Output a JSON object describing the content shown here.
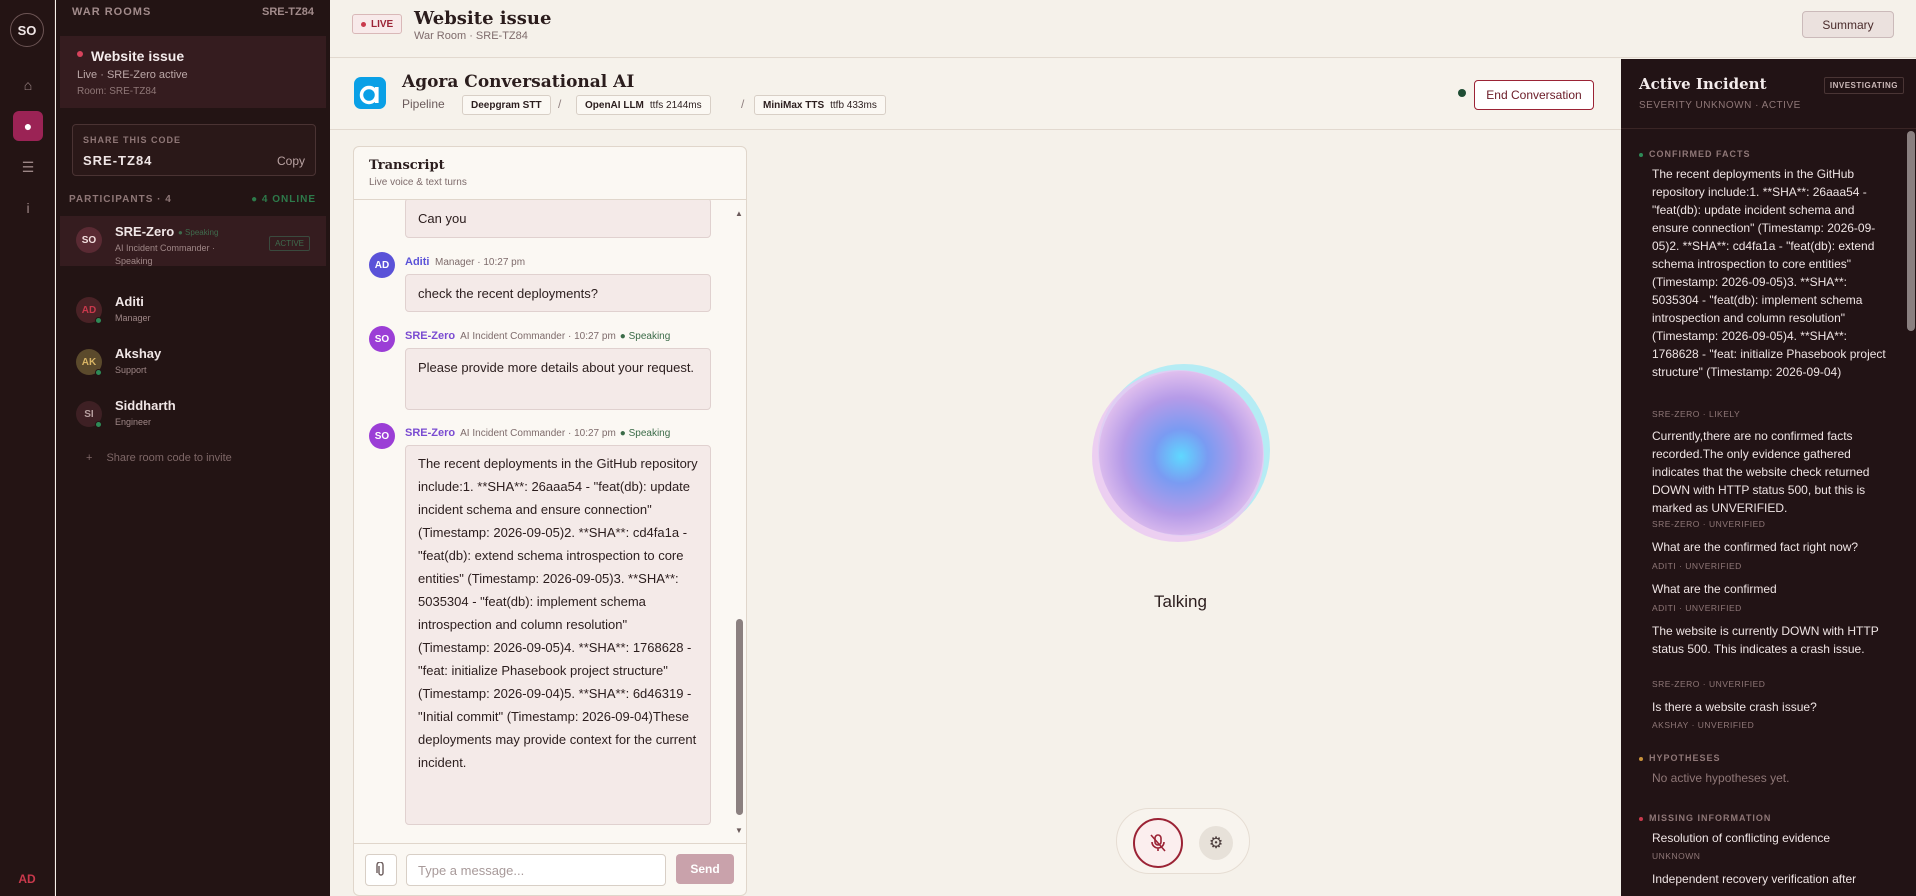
{
  "rail": {
    "logo": "SO",
    "footer": "AD"
  },
  "sidebar": {
    "header": "WAR ROOMS",
    "header_code": "SRE-TZ84",
    "room": {
      "title": "Website issue",
      "status": "Live · SRE-Zero active",
      "room_line": "Room: SRE-TZ84"
    },
    "share": {
      "label": "SHARE THIS CODE",
      "code": "SRE-TZ84",
      "copy": "Copy"
    },
    "participants_header": "PARTICIPANTS · 4",
    "online": "● 4 ONLINE",
    "participants": [
      {
        "initials": "SO",
        "name": "SRE-Zero",
        "role": "AI Incident Commander · Speaking",
        "tag": "● Speaking",
        "badge": "ACTIVE"
      },
      {
        "initials": "AD",
        "name": "Aditi",
        "role": "Manager"
      },
      {
        "initials": "AK",
        "name": "Akshay",
        "role": "Support"
      },
      {
        "initials": "SI",
        "name": "Siddharth",
        "role": "Engineer"
      }
    ],
    "invite_icon": "+",
    "invite": "Share room code to invite"
  },
  "topbar": {
    "live": "LIVE",
    "title": "Website issue",
    "subtitle": "War Room · SRE-TZ84",
    "summary": "Summary"
  },
  "agora": {
    "name": "Agora Conversational AI",
    "pipeline": "Pipeline",
    "stt": "Deepgram STT",
    "llm": "OpenAI LLM",
    "llm_ttfs": "ttfs 2144ms",
    "tts": "MiniMax TTS",
    "tts_ttfb": "ttfb 433ms",
    "sep": "/",
    "end": "End Conversation"
  },
  "transcript": {
    "title": "Transcript",
    "subtitle": "Live voice & text turns",
    "messages": [
      {
        "text": "Can you"
      },
      {
        "initials": "AD",
        "name": "Aditi",
        "meta": "Manager · 10:27 pm",
        "text": "check the recent deployments?"
      },
      {
        "initials": "SO",
        "name": "SRE-Zero",
        "meta": "AI Incident Commander · 10:27 pm",
        "speaking": "● Speaking",
        "text": "Please provide more details about your request."
      },
      {
        "initials": "SO",
        "name": "SRE-Zero",
        "meta": "AI Incident Commander · 10:27 pm",
        "speaking": "● Speaking",
        "text": "The recent deployments in the GitHub repository include:1. **SHA**: 26aaa54 - \"feat(db): update incident schema and ensure connection\" (Timestamp: 2026-09-05)2. **SHA**: cd4fa1a - \"feat(db): extend schema introspection to core entities\" (Timestamp: 2026-09-05)3. **SHA**: 5035304 - \"feat(db): implement schema introspection and column resolution\" (Timestamp: 2026-09-05)4. **SHA**: 1768628 - \"feat: initialize Phasebook project structure\" (Timestamp: 2026-09-04)5. **SHA**: 6d46319 - \"Initial commit\" (Timestamp: 2026-09-04)These deployments may provide context for the current incident."
      }
    ],
    "placeholder": "Type a message...",
    "send": "Send"
  },
  "agent": {
    "state": "Talking"
  },
  "incident": {
    "title": "Active Incident",
    "badge": "INVESTIGATING",
    "severity": "SEVERITY UNKNOWN · ACTIVE",
    "confirmed_header": "CONFIRMED FACTS",
    "facts": [
      {
        "text": "The recent deployments in the GitHub repository include:1. **SHA**: 26aaa54 - \"feat(db): update incident schema and ensure connection\" (Timestamp: 2026-09-05)2. **SHA**: cd4fa1a - \"feat(db): extend schema introspection to core entities\" (Timestamp: 2026-09-05)3. **SHA**: 5035304 - \"feat(db): implement schema introspection and column resolution\" (Timestamp: 2026-09-05)4. **SHA**: 1768628 - \"feat: initialize Phasebook project structure\" (Timestamp: 2026-09-04)",
        "source": "SRE-ZERO · LIKELY"
      },
      {
        "text": "Currently,there are no confirmed facts recorded.The only evidence gathered indicates that the website check returned DOWN with HTTP status 500, but this is marked as UNVERIFIED.",
        "source": "SRE-ZERO · UNVERIFIED"
      },
      {
        "text": "What are the confirmed fact right now?",
        "source": "ADITI · UNVERIFIED"
      },
      {
        "text": "What are the confirmed",
        "source": "ADITI · UNVERIFIED"
      },
      {
        "text": "The website is currently DOWN with HTTP status 500. This indicates a crash issue.",
        "source": "SRE-ZERO · UNVERIFIED"
      },
      {
        "text": "Is there a website crash issue?",
        "source": "AKSHAY · UNVERIFIED"
      }
    ],
    "hypotheses_header": "HYPOTHESES",
    "no_hypotheses": "No active hypotheses yet.",
    "missing_header": "MISSING INFORMATION",
    "missing": [
      {
        "text": "Resolution of conflicting evidence",
        "source": "UNKNOWN"
      },
      {
        "text": "Independent recovery verification after"
      }
    ]
  }
}
